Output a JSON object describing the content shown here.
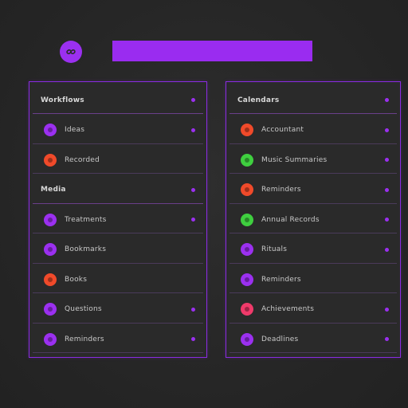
{
  "header": {
    "title": "",
    "accent": "#9a2cf0"
  },
  "logo": {
    "icon": "link-icon",
    "color": "#9b30f0"
  },
  "left_panel": {
    "rows": [
      {
        "type": "header",
        "label": "Workflows",
        "dot": true
      },
      {
        "type": "item",
        "label": "Ideas",
        "icon_color": "#9b30f0",
        "dot": true
      },
      {
        "type": "item",
        "label": "Recorded",
        "icon_color": "#f04a2a",
        "dot": false
      },
      {
        "type": "header",
        "label": "Media",
        "dot": true
      },
      {
        "type": "item",
        "label": "Treatments",
        "icon_color": "#9b30f0",
        "dot": true
      },
      {
        "type": "item",
        "label": "Bookmarks",
        "icon_color": "#9b30f0",
        "dot": false
      },
      {
        "type": "item",
        "label": "Books",
        "icon_color": "#f04a2a",
        "dot": false
      },
      {
        "type": "item",
        "label": "Questions",
        "icon_color": "#9b30f0",
        "dot": true
      },
      {
        "type": "item",
        "label": "Reminders",
        "icon_color": "#9b30f0",
        "dot": true
      }
    ]
  },
  "right_panel": {
    "rows": [
      {
        "type": "header",
        "label": "Calendars",
        "dot": true
      },
      {
        "type": "item",
        "label": "Accountant",
        "icon_color": "#f04a2a",
        "dot": true
      },
      {
        "type": "item",
        "label": "Music Summaries",
        "icon_color": "#3fcf3f",
        "dot": true
      },
      {
        "type": "item",
        "label": "Reminders",
        "icon_color": "#f04a2a",
        "dot": true
      },
      {
        "type": "item",
        "label": "Annual Records",
        "icon_color": "#3fcf3f",
        "dot": true
      },
      {
        "type": "item",
        "label": "Rituals",
        "icon_color": "#9b30f0",
        "dot": true
      },
      {
        "type": "item",
        "label": "Reminders",
        "icon_color": "#9b30f0",
        "dot": false
      },
      {
        "type": "item",
        "label": "Achievements",
        "icon_color": "#f03a6a",
        "dot": true
      },
      {
        "type": "item",
        "label": "Deadlines",
        "icon_color": "#9b30f0",
        "dot": true
      }
    ]
  }
}
